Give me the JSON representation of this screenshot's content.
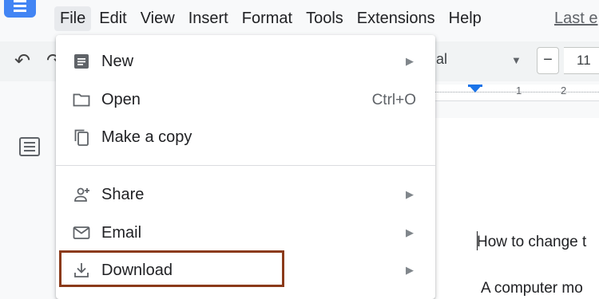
{
  "menubar": {
    "items": [
      "File",
      "Edit",
      "View",
      "Insert",
      "Format",
      "Tools",
      "Extensions",
      "Help"
    ],
    "last_edit": "Last e"
  },
  "toolbar": {
    "font_name": "al",
    "font_size": "11",
    "minus": "−"
  },
  "ruler": {
    "nums": [
      "1",
      "2"
    ]
  },
  "file_menu": {
    "items": [
      {
        "label": "New",
        "icon": "doc-icon",
        "submenu": true
      },
      {
        "label": "Open",
        "icon": "folder-icon",
        "shortcut": "Ctrl+O"
      },
      {
        "label": "Make a copy",
        "icon": "copy-icon"
      },
      {
        "label": "Share",
        "icon": "person-add-icon",
        "submenu": true
      },
      {
        "label": "Email",
        "icon": "mail-icon",
        "submenu": true
      },
      {
        "label": "Download",
        "icon": "download-icon",
        "submenu": true
      }
    ],
    "arrow": "▶"
  },
  "document": {
    "line1": "How to change t",
    "line2": "A computer mo"
  },
  "colors": {
    "accent": "#1a73e8",
    "highlight_border": "#8b3a1a",
    "highlight_fill": "#fce8f3"
  }
}
